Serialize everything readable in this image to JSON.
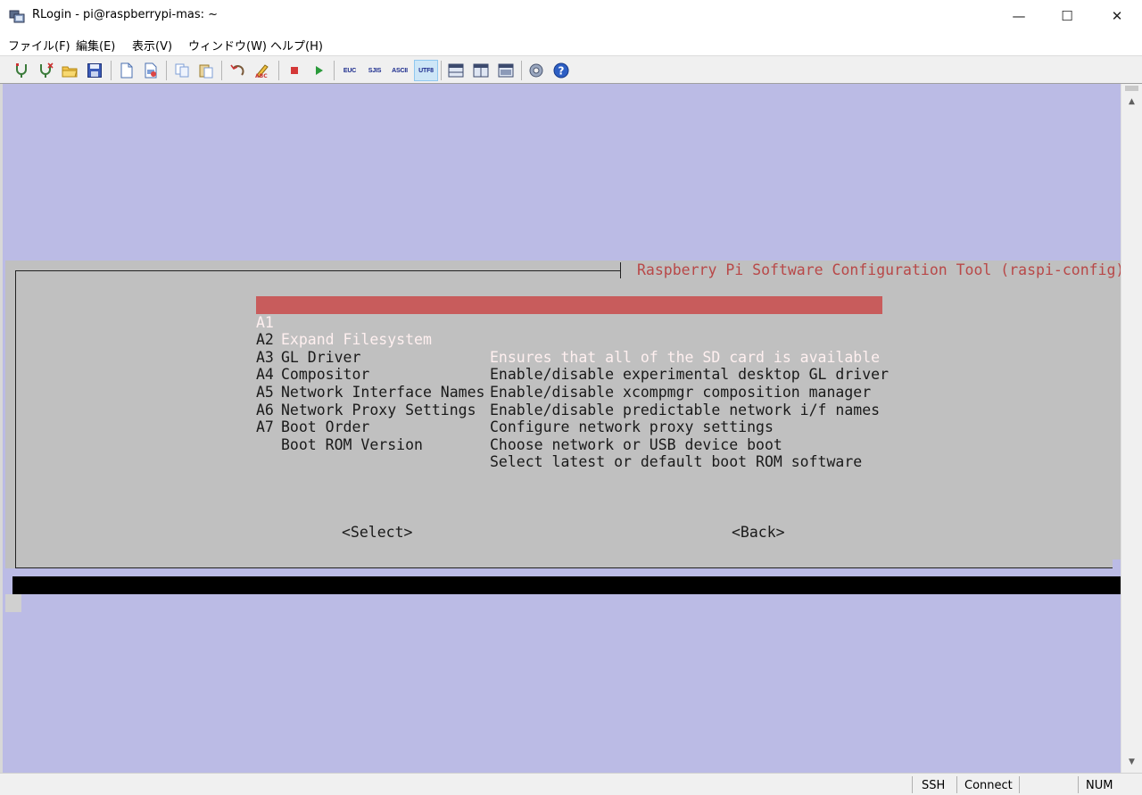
{
  "window": {
    "title": "RLogin - pi@raspberrypi-mas: ~",
    "minimize": "—",
    "maximize": "☐",
    "close": "✕"
  },
  "menu": [
    {
      "label": "ファイル(F)"
    },
    {
      "label": "編集(E)"
    },
    {
      "label": "表示(V)"
    },
    {
      "label": "ウィンドウ(W)"
    },
    {
      "label": "ヘルプ(H)"
    }
  ],
  "toolbar": {
    "euc": "EUC",
    "sjis": "SJIS",
    "ascii": "ASCII",
    "utf8": "UTF8",
    "icons": [
      "connect-icon",
      "disconnect-icon",
      "open-folder-icon",
      "save-icon",
      "new-document-icon",
      "print-icon",
      "copy-icon",
      "paste-icon",
      "undo-icon",
      "spellcheck-icon",
      "stop-icon",
      "play-icon",
      "euc-icon",
      "sjis-icon",
      "ascii-icon",
      "utf8-icon",
      "layout-horizontal-icon",
      "layout-split-icon",
      "layout-full-icon",
      "settings-icon",
      "help-icon"
    ]
  },
  "terminal": {
    "dialog_title": "Raspberry Pi Software Configuration Tool (raspi-config)",
    "items": [
      {
        "code": "A1",
        "name": "Expand Filesystem",
        "desc": "Ensures that all of the SD card is available"
      },
      {
        "code": "A2",
        "name": "GL Driver",
        "desc": "Enable/disable experimental desktop GL driver"
      },
      {
        "code": "A3",
        "name": "Compositor",
        "desc": "Enable/disable xcompmgr composition manager"
      },
      {
        "code": "A4",
        "name": "Network Interface Names",
        "desc": "Enable/disable predictable network i/f names"
      },
      {
        "code": "A5",
        "name": "Network Proxy Settings",
        "desc": "Configure network proxy settings"
      },
      {
        "code": "A6",
        "name": "Boot Order",
        "desc": "Choose network or USB device boot"
      },
      {
        "code": "A7",
        "name": "Boot ROM Version",
        "desc": "Select latest or default boot ROM software"
      }
    ],
    "select_button": "<Select>",
    "back_button": "<Back>"
  },
  "status": {
    "protocol": "SSH",
    "state": "Connect",
    "num": "NUM"
  },
  "colors": {
    "terminal_bg": "#bbbbe5",
    "dialog_bg": "#c0c0c0",
    "selection": "#c85c5c",
    "title_text": "#b84848"
  }
}
